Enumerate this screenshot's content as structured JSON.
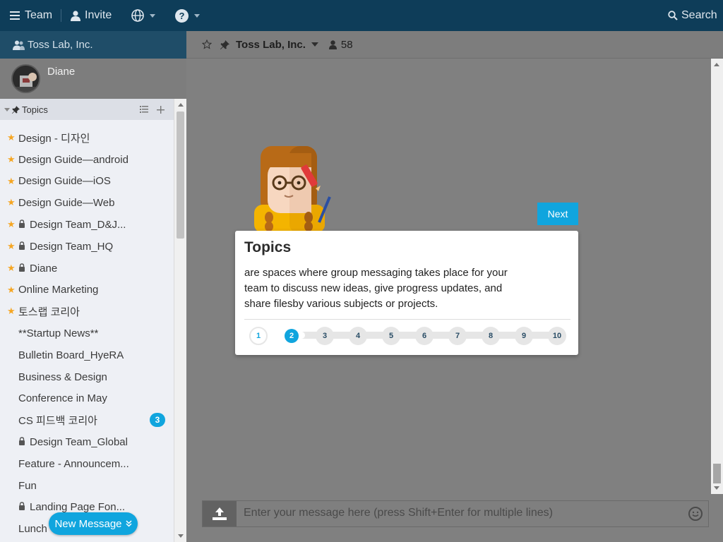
{
  "topbar": {
    "team_label": "Team",
    "invite_label": "Invite",
    "search_label": "Search"
  },
  "sidebar": {
    "team_name": "Toss Lab, Inc.",
    "user_name": "Diane",
    "topics_header": "Topics",
    "topics": [
      {
        "label": "Design - 디자인",
        "starred": true,
        "locked": false
      },
      {
        "label": "Design Guide—android",
        "starred": true,
        "locked": false
      },
      {
        "label": "Design Guide—iOS",
        "starred": true,
        "locked": false
      },
      {
        "label": "Design Guide—Web",
        "starred": true,
        "locked": false
      },
      {
        "label": "Design Team_D&J...",
        "starred": true,
        "locked": true
      },
      {
        "label": "Design Team_HQ",
        "starred": true,
        "locked": true
      },
      {
        "label": "Diane",
        "starred": true,
        "locked": true
      },
      {
        "label": "Online Marketing",
        "starred": true,
        "locked": false
      },
      {
        "label": "토스랩 코리아",
        "starred": true,
        "locked": false
      },
      {
        "label": "**Startup News**",
        "starred": false,
        "locked": false
      },
      {
        "label": "Bulletin Board_HyeRA",
        "starred": false,
        "locked": false
      },
      {
        "label": "Business & Design",
        "starred": false,
        "locked": false
      },
      {
        "label": "Conference in May",
        "starred": false,
        "locked": false
      },
      {
        "label": "CS 피드백 코리아",
        "starred": false,
        "locked": false,
        "badge": "3"
      },
      {
        "label": "Design Team_Global",
        "starred": false,
        "locked": true
      },
      {
        "label": "Feature - Announcem...",
        "starred": false,
        "locked": false
      },
      {
        "label": "Fun",
        "starred": false,
        "locked": false
      },
      {
        "label": "Landing Page Fon...",
        "starred": false,
        "locked": true
      },
      {
        "label": "Lunch",
        "starred": false,
        "locked": false
      }
    ],
    "new_message_label": "New Message"
  },
  "main": {
    "title": "Toss Lab, Inc.",
    "member_count": "58",
    "composer_placeholder": "Enter your message here (press Shift+Enter for multiple lines)"
  },
  "tour": {
    "next_label": "Next",
    "title": "Topics",
    "body": "are spaces where group messaging takes place for your team to discuss new ideas, give progress updates, and share filesby various subjects or projects.",
    "steps": [
      "1",
      "2",
      "3",
      "4",
      "5",
      "6",
      "7",
      "8",
      "9",
      "10"
    ],
    "current_step": 2
  },
  "colors": {
    "topbar_bg": "#0e3d59",
    "accent": "#10a5de",
    "star": "#f5a623"
  }
}
